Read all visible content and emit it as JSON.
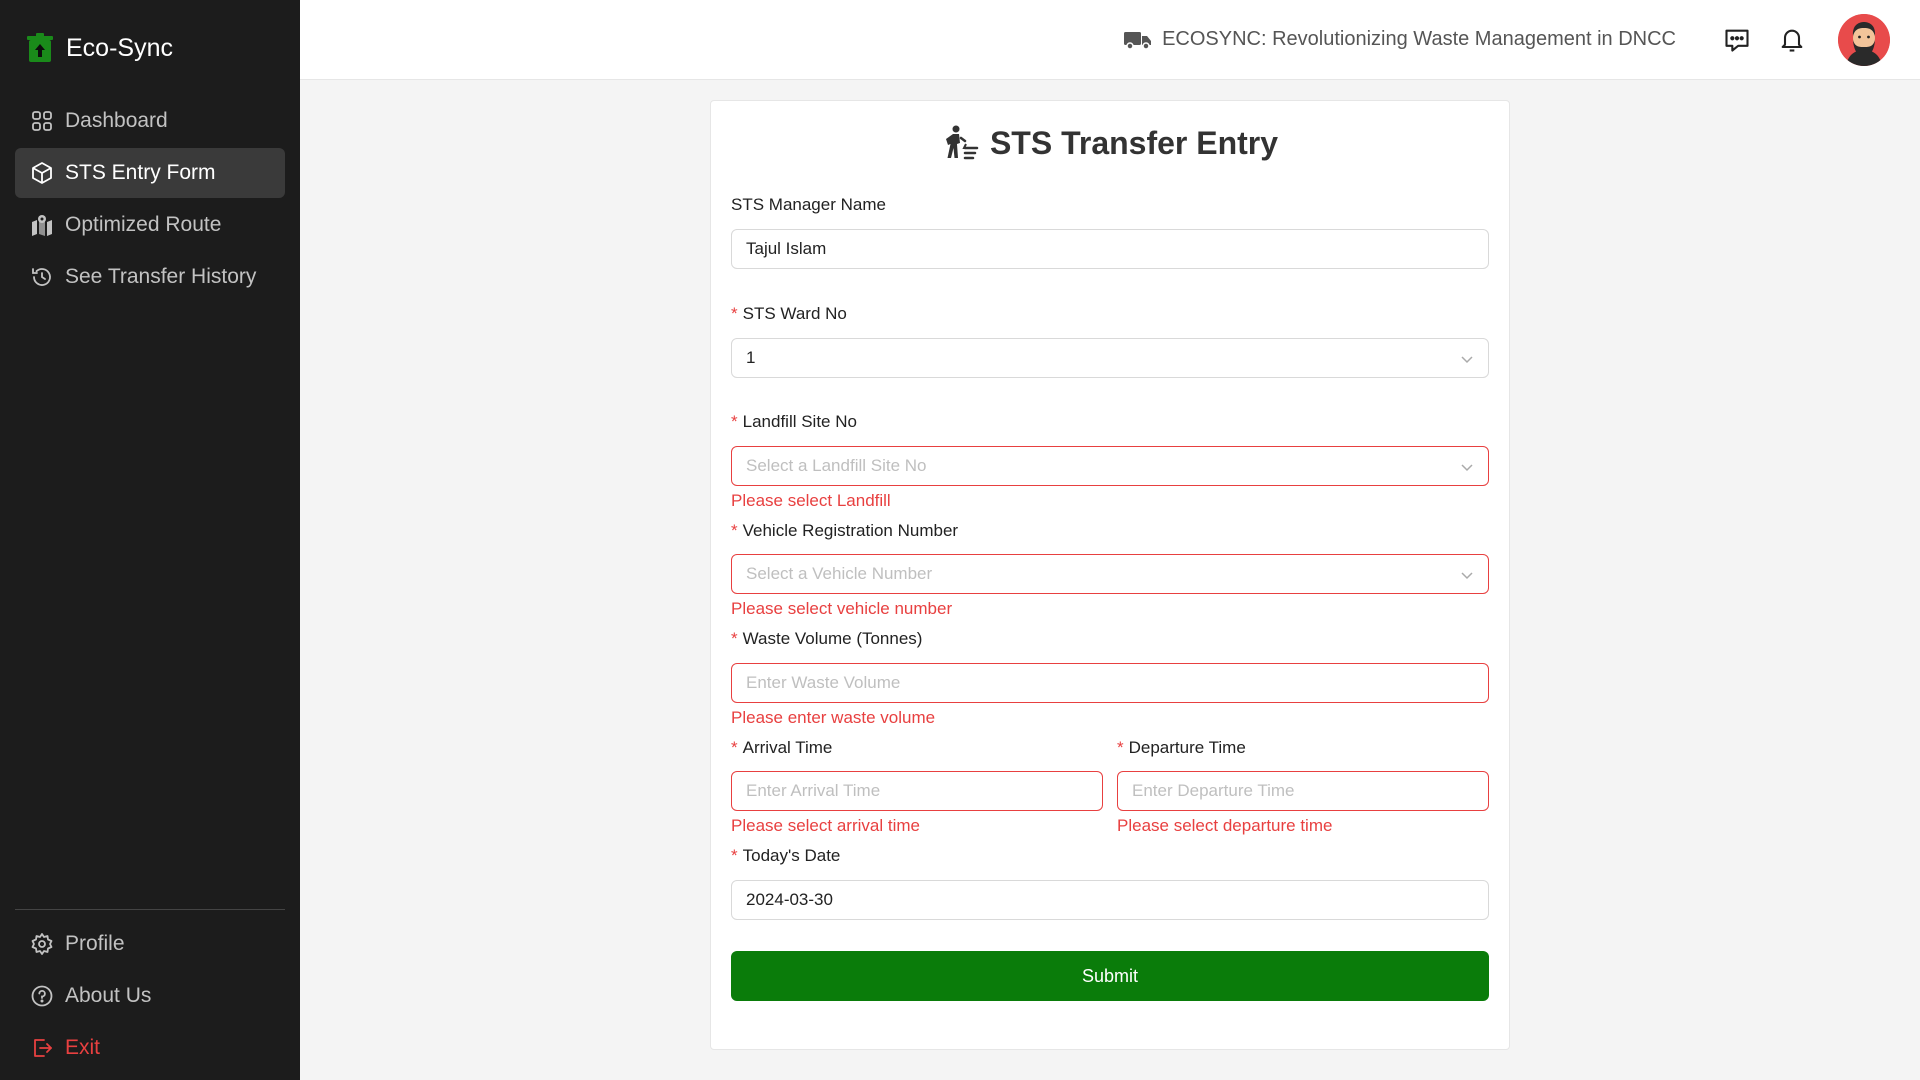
{
  "app": {
    "brand": "Eco-Sync",
    "accent": "#0a7c0a",
    "error_color": "#e84040"
  },
  "sidebar": {
    "items": [
      {
        "label": "Dashboard",
        "icon": "grid-icon"
      },
      {
        "label": "STS Entry Form",
        "icon": "cube-icon",
        "active": true
      },
      {
        "label": "Optimized Route",
        "icon": "map-icon"
      },
      {
        "label": "See Transfer History",
        "icon": "history-icon"
      }
    ],
    "bottom": [
      {
        "label": "Profile",
        "icon": "gear-icon"
      },
      {
        "label": "About Us",
        "icon": "help-icon"
      },
      {
        "label": "Exit",
        "icon": "logout-icon"
      }
    ]
  },
  "header": {
    "title": "ECOSYNC: Revolutionizing Waste Management in DNCC",
    "icons": [
      "truck-icon",
      "chat-icon",
      "bell-icon",
      "avatar"
    ]
  },
  "form": {
    "title": "STS Transfer Entry",
    "manager": {
      "label": "STS Manager Name",
      "value": "Tajul Islam"
    },
    "ward": {
      "label": "STS Ward No",
      "value": "1"
    },
    "landfill": {
      "label": "Landfill Site No",
      "placeholder": "Select a Landfill Site No",
      "error": "Please select Landfill"
    },
    "vehicle": {
      "label": "Vehicle Registration Number",
      "placeholder": "Select a Vehicle Number",
      "error": "Please select vehicle number"
    },
    "volume": {
      "label": "Waste Volume (Tonnes)",
      "placeholder": "Enter Waste Volume",
      "error": "Please enter waste volume"
    },
    "arrival": {
      "label": "Arrival Time",
      "placeholder": "Enter Arrival Time",
      "error": "Please select arrival time"
    },
    "departure": {
      "label": "Departure Time",
      "placeholder": "Enter Departure Time",
      "error": "Please select departure time"
    },
    "date": {
      "label": "Today's Date",
      "value": "2024-03-30"
    },
    "submit_label": "Submit"
  }
}
